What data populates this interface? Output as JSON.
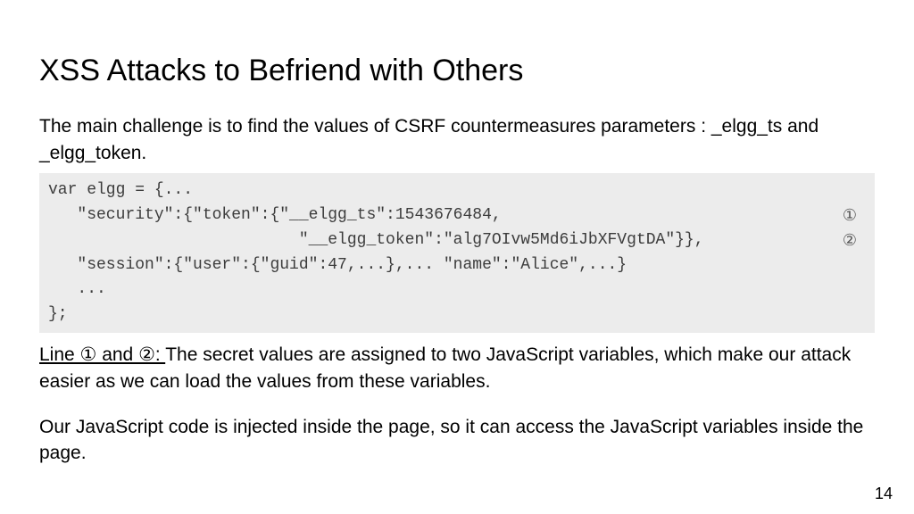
{
  "title": "XSS Attacks to Befriend with Others",
  "intro": "The main challenge is to find the values of CSRF countermeasures parameters : _elgg_ts and _elgg_token.",
  "code": {
    "l1": "var elgg = {...",
    "l2": "   \"security\":{\"token\":{\"__elgg_ts\":1543676484,",
    "l3": "                          \"__elgg_token\":\"alg7OIvw5Md6iJbXFVgtDA\"}},",
    "l4": "   \"session\":{\"user\":{\"guid\":47,...},... \"name\":\"Alice\",...}",
    "l5": "   ...",
    "l6": "};",
    "m1": "①",
    "m2": "②"
  },
  "explain_label": "Line ① and ②: ",
  "explain_body": "The secret values are assigned to two JavaScript variables, which make our attack easier as we can load the values from these variables.",
  "para2": "Our JavaScript code is injected inside the page, so it can access the JavaScript variables inside the page.",
  "page_number": "14"
}
